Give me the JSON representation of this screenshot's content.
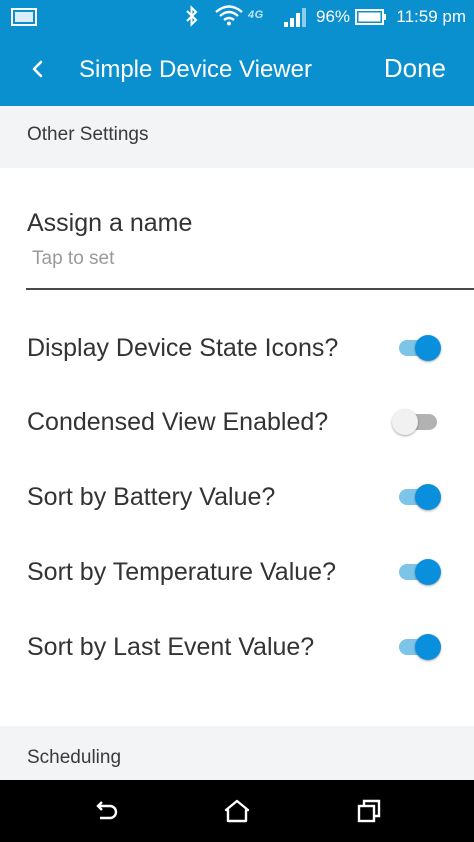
{
  "status_bar": {
    "net_type": "4G",
    "battery_percent": "96%",
    "time": "11:59 pm",
    "icons": [
      "gallery-icon",
      "bluetooth-icon",
      "wifi-icon",
      "signal-icon",
      "battery-icon"
    ]
  },
  "app_bar": {
    "back_icon": "back-chevron-icon",
    "title": "Simple Device Viewer",
    "done_label": "Done"
  },
  "sections": {
    "other_settings": "Other Settings",
    "scheduling": "Scheduling"
  },
  "name_setting": {
    "label": "Assign a name",
    "hint": "Tap to set"
  },
  "toggles": [
    {
      "label": "Display Device State Icons?",
      "enabled": true
    },
    {
      "label": "Condensed View Enabled?",
      "enabled": false
    },
    {
      "label": "Sort by Battery Value?",
      "enabled": true
    },
    {
      "label": "Sort by Temperature Value?",
      "enabled": true
    },
    {
      "label": "Sort by Last Event Value?",
      "enabled": true
    }
  ],
  "nav_bar": {
    "icons": [
      "nav-back-icon",
      "nav-home-icon",
      "nav-recents-icon"
    ]
  },
  "colors": {
    "accent": "#0a8fcf",
    "switch_on": "#0a8fdc",
    "switch_on_track": "#7dc4e9",
    "switch_off_track": "#b2b2b2",
    "section_bg": "#f2f4f5"
  }
}
